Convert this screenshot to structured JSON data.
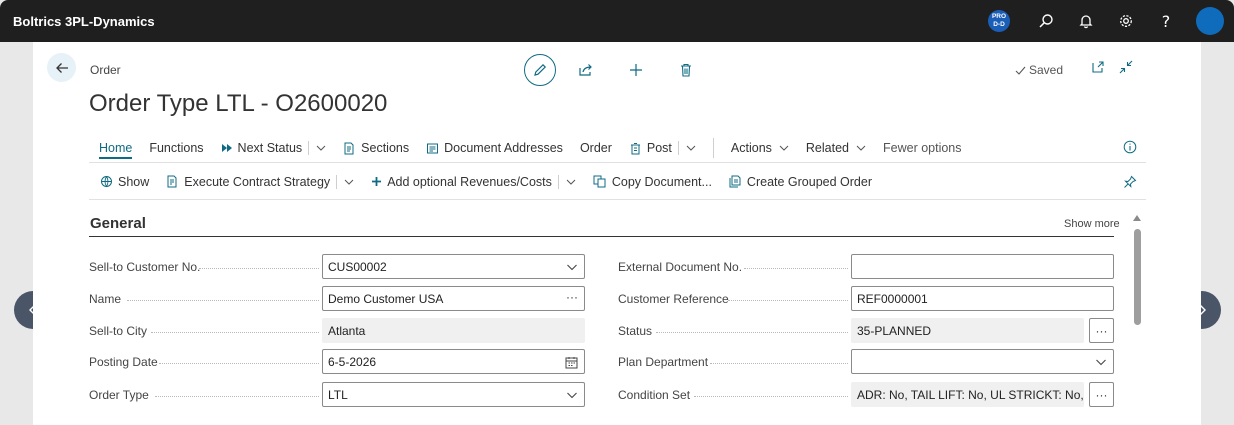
{
  "app": {
    "brand": "Boltrics 3PL-Dynamics",
    "env_badge_line1": "PRO",
    "env_badge_line2": "D-D",
    "help_label": "?"
  },
  "page": {
    "breadcrumb": "Order",
    "title": "Order Type LTL - O2600020",
    "saved_label": "Saved"
  },
  "actions_row1": {
    "home": "Home",
    "functions": "Functions",
    "next_status": "Next Status",
    "sections": "Sections",
    "document_addresses": "Document Addresses",
    "order": "Order",
    "post": "Post",
    "actions": "Actions",
    "related": "Related",
    "fewer_options": "Fewer options"
  },
  "actions_row2": {
    "show": "Show",
    "execute_contract_strategy": "Execute Contract Strategy",
    "add_optional_revenues_costs": "Add optional Revenues/Costs",
    "copy_document": "Copy Document...",
    "create_grouped_order": "Create Grouped Order"
  },
  "general": {
    "title": "General",
    "show_more": "Show more",
    "left_fields": [
      {
        "label": "Sell-to Customer No.",
        "value": "CUS00002",
        "type": "dropdown"
      },
      {
        "label": "Name",
        "value": "Demo Customer USA",
        "type": "lookup"
      },
      {
        "label": "Sell-to City",
        "value": "Atlanta",
        "type": "readonly"
      },
      {
        "label": "Posting Date",
        "value": "6-5-2026",
        "type": "date"
      },
      {
        "label": "Order Type",
        "value": "LTL",
        "type": "dropdown"
      }
    ],
    "right_fields": [
      {
        "label": "External Document No.",
        "value": "",
        "type": "text"
      },
      {
        "label": "Customer Reference",
        "value": "REF0000001",
        "type": "text"
      },
      {
        "label": "Status",
        "value": "35-PLANNED",
        "type": "readonly-more"
      },
      {
        "label": "Plan Department",
        "value": "",
        "type": "dropdown"
      },
      {
        "label": "Condition Set",
        "value": "ADR: No, TAIL LIFT: No, UL STRICKT: No, U...",
        "type": "readonly-more"
      }
    ]
  },
  "colors": {
    "accent": "#0f6b83",
    "appbar": "#1f1f1f",
    "avatar": "#0f6cbd",
    "env_badge": "#1b5eb8",
    "nav_arrow": "#4a5568"
  }
}
